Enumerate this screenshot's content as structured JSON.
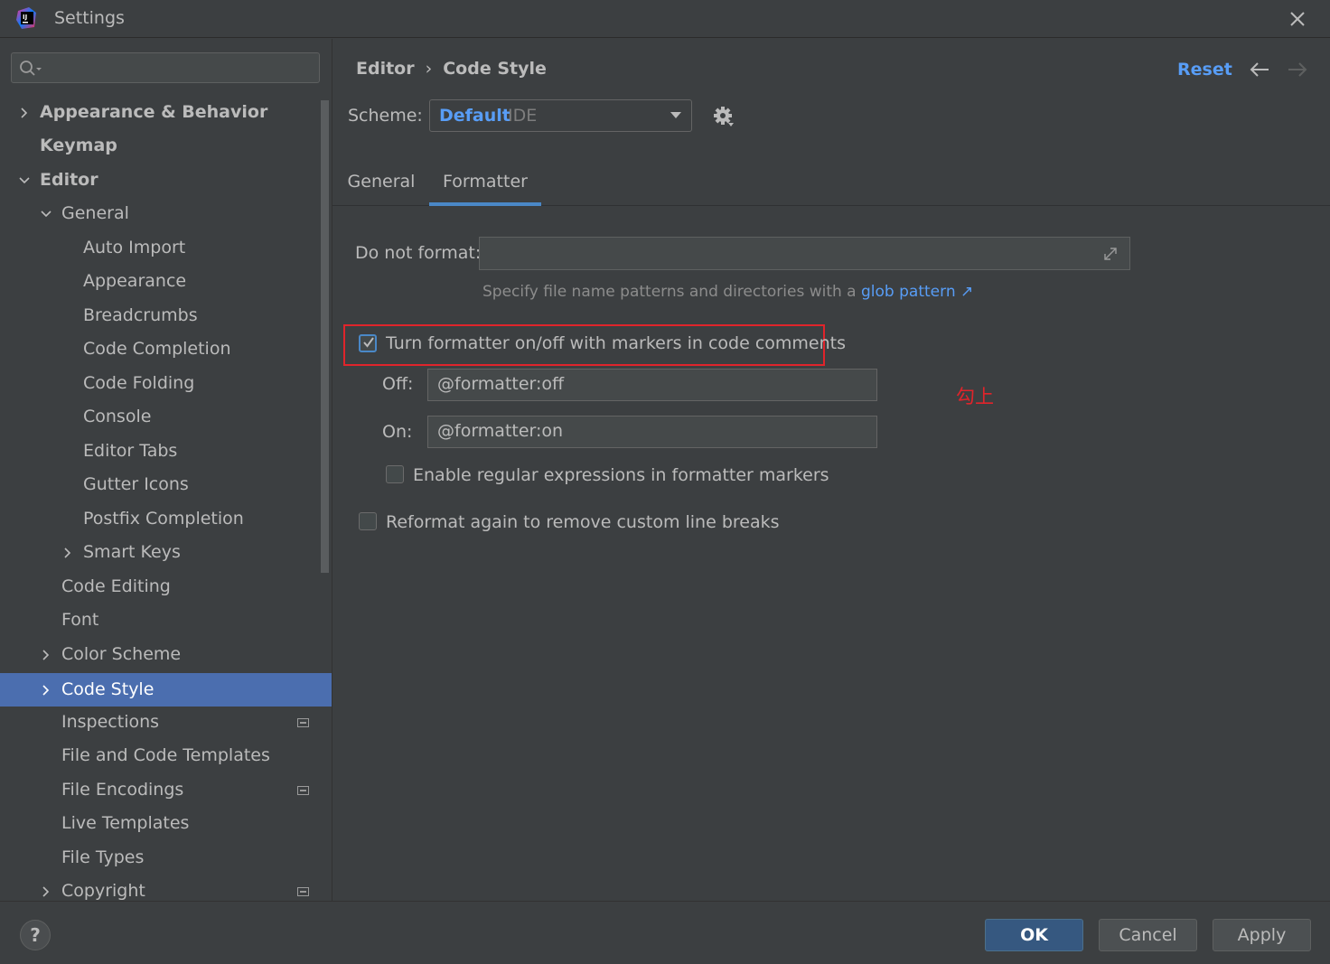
{
  "window": {
    "title": "Settings"
  },
  "search": {
    "placeholder": ""
  },
  "sidebar": {
    "items": [
      {
        "label": "Appearance & Behavior"
      },
      {
        "label": "Keymap"
      },
      {
        "label": "Editor"
      },
      {
        "label": "General"
      },
      {
        "label": "Auto Import"
      },
      {
        "label": "Appearance"
      },
      {
        "label": "Breadcrumbs"
      },
      {
        "label": "Code Completion"
      },
      {
        "label": "Code Folding"
      },
      {
        "label": "Console"
      },
      {
        "label": "Editor Tabs"
      },
      {
        "label": "Gutter Icons"
      },
      {
        "label": "Postfix Completion"
      },
      {
        "label": "Smart Keys"
      },
      {
        "label": "Code Editing"
      },
      {
        "label": "Font"
      },
      {
        "label": "Color Scheme"
      },
      {
        "label": "Code Style"
      },
      {
        "label": "Inspections"
      },
      {
        "label": "File and Code Templates"
      },
      {
        "label": "File Encodings"
      },
      {
        "label": "Live Templates"
      },
      {
        "label": "File Types"
      },
      {
        "label": "Copyright"
      }
    ]
  },
  "header": {
    "breadcrumb_parent": "Editor",
    "breadcrumb_sep": "›",
    "breadcrumb_current": "Code Style",
    "reset_label": "Reset"
  },
  "scheme": {
    "label": "Scheme:",
    "name": "Default",
    "type": "IDE"
  },
  "tabs": [
    {
      "label": "General"
    },
    {
      "label": "Formatter"
    }
  ],
  "formatter": {
    "do_not_format_label": "Do not format:",
    "do_not_format_value": "",
    "hint_text": "Specify file name patterns and directories with a",
    "hint_link": "glob pattern ↗",
    "markers_checkbox_label": "Turn formatter on/off with markers in code comments",
    "markers_checked": true,
    "off_label": "Off:",
    "off_value": "@formatter:off",
    "on_label": "On:",
    "on_value": "@formatter:on",
    "regex_checkbox_label": "Enable regular expressions in formatter markers",
    "regex_checked": false,
    "reformat_checkbox_label": "Reformat again to remove custom line breaks",
    "reformat_checked": false
  },
  "annotation": {
    "text": "勾上",
    "color": "#e0242b"
  },
  "footer": {
    "help_label": "?",
    "ok_label": "OK",
    "cancel_label": "Cancel",
    "apply_label": "Apply"
  },
  "colors": {
    "accent": "#4a88c7",
    "link": "#589df6",
    "selection": "#4b6eaf",
    "highlight_box": "#e0242b"
  }
}
